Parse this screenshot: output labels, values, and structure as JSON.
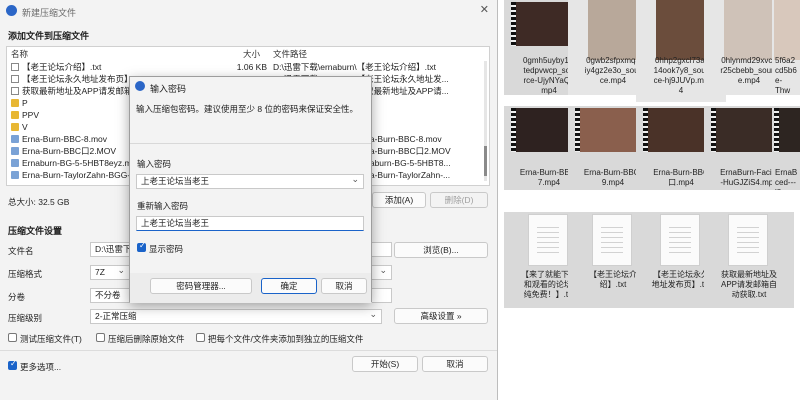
{
  "explorer": {
    "tiles": [
      {
        "label": "0gmh5uyby1l8\ntedpvwcp_sou\nrce-UjyNYaQf.\nmp4",
        "kind": "video"
      },
      {
        "label": "0gwb2sfpxmqa\niy4gz2e3o_sour\nce.mp4",
        "kind": "video"
      },
      {
        "label": "0hhp2gxcl73af\n14ook7y8_sour\nce-hj9JUVp.mp\n4",
        "kind": "video"
      },
      {
        "label": "0hlynmd29xvcb\nr25cbebb_sourc\ne.mp4",
        "kind": "video"
      },
      {
        "label": "5f6a2\ncd5b6\ne-Thw",
        "kind": "video"
      },
      {
        "label": "Erna-Burn-BBC-\n7.mp4",
        "kind": "video"
      },
      {
        "label": "Erna-Burn-BBC-\n9.mp4",
        "kind": "video"
      },
      {
        "label": "Erna-Burn-BBC\n口.mp4",
        "kind": "video"
      },
      {
        "label": "ErnaBurn-Facial\n-HuGJZiS4.mp4",
        "kind": "video"
      },
      {
        "label": "ErnaB\nced---\nl8e",
        "kind": "video"
      },
      {
        "label": "【来了就能下载\n和观看的论坛,\n纯免费！】.txt",
        "kind": "text"
      },
      {
        "label": "【老王论坛介\n绍】.txt",
        "kind": "text"
      },
      {
        "label": "【老王论坛永久\n地址发布页】.txt",
        "kind": "text"
      },
      {
        "label": "获取最新地址及\nAPP请发邮箱自\n动获取.txt",
        "kind": "text"
      }
    ]
  },
  "main_window": {
    "title": "新建压缩文件",
    "add_section_title": "添加文件到压缩文件",
    "columns": {
      "name": "名称",
      "size": "大小",
      "path": "文件路径"
    },
    "files": [
      {
        "name": "【老王论坛介绍】.txt",
        "size": "1.06 KB",
        "path": "D:\\迅雷下载\\ernaburn\\【老王论坛介绍】.txt",
        "type": "txt"
      },
      {
        "name": "【老王论坛永久地址发布页】.t",
        "size": "",
        "path": "D:\\迅雷下载\\ernaburn\\【老王论坛永久地址发...",
        "type": "txt"
      },
      {
        "name": "获取最新地址及APP请发邮箱自",
        "size": "",
        "path": "D:\\迅雷下载\\ernaburn\\获取最新地址及APP请...",
        "type": "txt"
      },
      {
        "name": "P",
        "size": "",
        "path": "",
        "type": "folder"
      },
      {
        "name": "PPV",
        "size": "",
        "path": "",
        "type": "folder"
      },
      {
        "name": "V",
        "size": "",
        "path": "",
        "type": "folder"
      },
      {
        "name": "Erna-Burn-BBC-8.mov",
        "size": "",
        "path": "D:\\迅雷下载\\ernaburn\\Erna-Burn-BBC-8.mov",
        "type": "video"
      },
      {
        "name": "Erna-Burn-BBC口2.MOV",
        "size": "",
        "path": "D:\\迅雷下载\\ernaburn\\Erna-Burn-BBC口2.MOV",
        "type": "video"
      },
      {
        "name": "Ernaburn-BG-5-5HBT8eyz.m",
        "size": "",
        "path": "D:\\迅雷下载\\ernaburn\\Ernaburn-BG-5-5HBT8...",
        "type": "video"
      },
      {
        "name": "Erna-Burn-TaylorZahn-BGG-",
        "size": "",
        "path": "D:\\迅雷下载\\ernaburn\\Erna-Burn-TaylorZahn-...",
        "type": "video"
      }
    ],
    "total_size": "总大小: 32.5 GB",
    "add_button": "添加(A)",
    "delete_button": "删除(D)",
    "settings_section_title": "压缩文件设置",
    "filename_label": "文件名",
    "filename_value": "D:\\迅雷下",
    "browse_button": "浏览(B)...",
    "format_label": "压缩格式",
    "format_value": "7Z",
    "split_label": "分卷",
    "split_value": "不分卷",
    "level_label": "压缩级别",
    "level_value": "2-正常压缩",
    "advanced_button": "高级设置 »",
    "test_checkbox": "测试压缩文件(T)",
    "delete_after_checkbox": "压缩后删除原始文件",
    "separate_checkbox": "把每个文件/文件夹添加到独立的压缩文件",
    "more_options": "更多选项...",
    "start_button": "开始(S)",
    "cancel_button": "取消"
  },
  "password_dialog": {
    "title": "输入密码",
    "description": "输入压缩包密码。建议使用至少 8 位的密码来保证安全性。",
    "password_label": "输入密码",
    "password_value": "上老王论坛当老王",
    "confirm_label": "重新输入密码",
    "confirm_value": "上老王论坛当老王",
    "show_password": "显示密码",
    "show_password_checked": true,
    "manager_button": "密码管理器...",
    "ok_button": "确定",
    "cancel_button": "取消"
  }
}
